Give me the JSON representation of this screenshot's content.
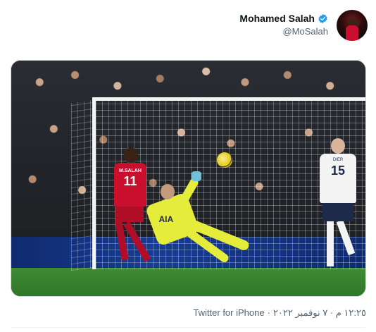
{
  "author": {
    "display_name": "Mohamed Salah",
    "handle": "@MoSalah",
    "verified": true,
    "verified_color": "#1d9bf0"
  },
  "photo": {
    "players": {
      "salah": {
        "shirt_name": "M.SALAH",
        "shirt_number": "11"
      },
      "lloris": {
        "sponsor": "AIA"
      },
      "dier": {
        "shirt_name": "DIER",
        "shirt_number": "15"
      }
    }
  },
  "meta": {
    "timestamp": "١٢:٢٥ م · ٧ نوفمبر ٢٠٢٢",
    "separator": " · ",
    "source": "Twitter for iPhone"
  },
  "colors": {
    "text_primary": "#0f1419",
    "text_secondary": "#536471"
  }
}
